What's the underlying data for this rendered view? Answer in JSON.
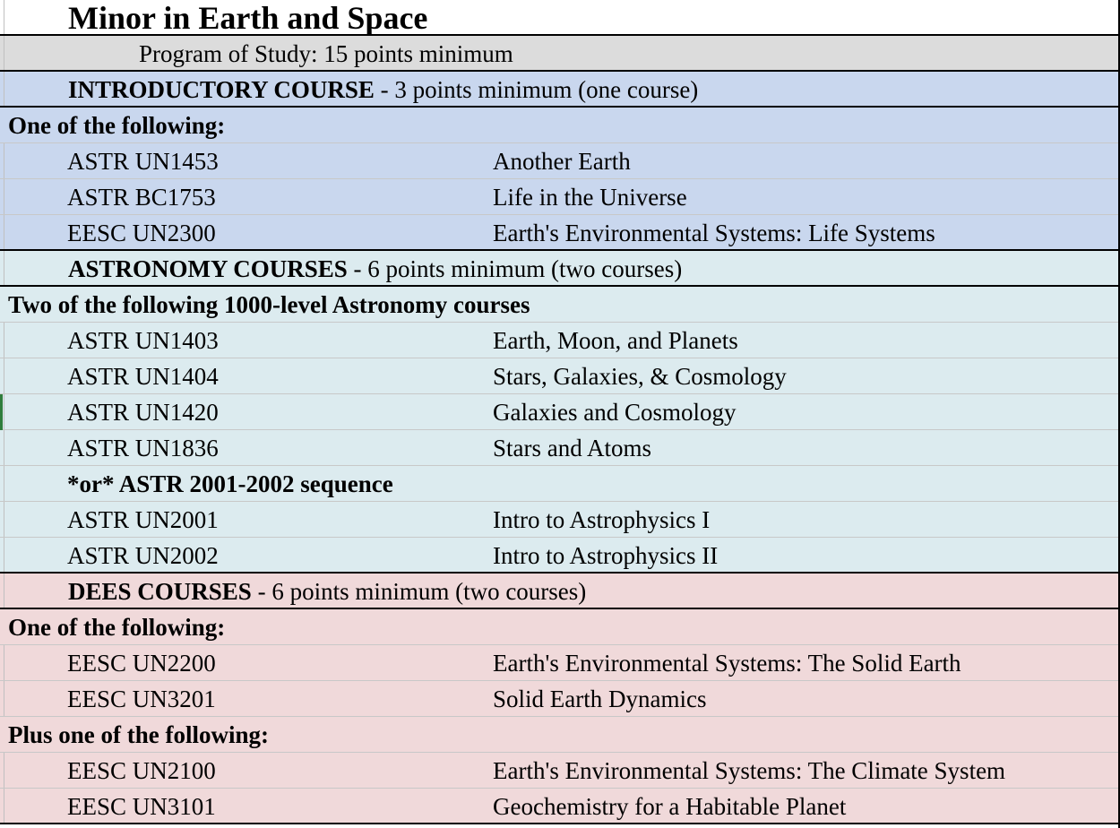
{
  "title": "Minor in Earth and Space",
  "program": "Program of Study: 15 points minimum",
  "intro": {
    "heading_bold": "INTRODUCTORY COURSE",
    "heading_rest": " -  3 points minimum (one course)",
    "label": "One of the following:",
    "courses": [
      {
        "code": "ASTR UN1453",
        "name": "Another Earth"
      },
      {
        "code": "ASTR BC1753",
        "name": "Life in the Universe"
      },
      {
        "code": "EESC UN2300",
        "name": "Earth's Environmental Systems: Life Systems"
      }
    ]
  },
  "astro": {
    "heading_bold": "ASTRONOMY COURSES",
    "heading_rest": " - 6 points minimum (two courses)",
    "label": "Two of the following 1000-level Astronomy courses",
    "courses": [
      {
        "code": "ASTR UN1403",
        "name": "Earth, Moon, and Planets"
      },
      {
        "code": "ASTR UN1404",
        "name": "Stars, Galaxies, & Cosmology"
      },
      {
        "code": "ASTR UN1420",
        "name": "Galaxies and Cosmology"
      },
      {
        "code": "ASTR UN1836",
        "name": "Stars and Atoms"
      }
    ],
    "seq_label": "*or* ASTR 2001-2002 sequence",
    "seq_courses": [
      {
        "code": "ASTR UN2001",
        "name": "Intro to Astrophysics I"
      },
      {
        "code": "ASTR UN2002",
        "name": "Intro to Astrophysics II"
      }
    ]
  },
  "dees": {
    "heading_bold": "DEES COURSES",
    "heading_rest": " - 6 points minimum (two courses)",
    "label1": "One of the following:",
    "courses1": [
      {
        "code": "EESC UN2200",
        "name": "Earth's Environmental Systems: The Solid Earth"
      },
      {
        "code": "EESC UN3201",
        "name": "Solid Earth Dynamics"
      }
    ],
    "label2": "Plus one of the following:",
    "courses2": [
      {
        "code": "EESC UN2100",
        "name": "Earth's Environmental Systems: The Climate System"
      },
      {
        "code": "EESC UN3101",
        "name": "Geochemistry for a Habitable Planet"
      }
    ]
  }
}
